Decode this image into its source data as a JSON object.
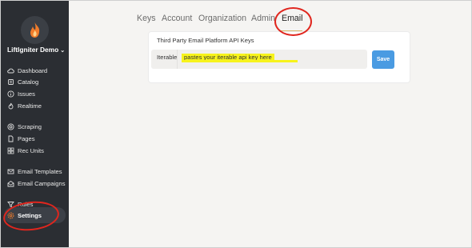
{
  "brand": {
    "name": "LiftIgniter Demo",
    "accent": "#f07c2b"
  },
  "sidebar": {
    "items": [
      {
        "label": "Dashboard",
        "icon": "cloud-icon"
      },
      {
        "label": "Catalog",
        "icon": "book-icon"
      },
      {
        "label": "Issues",
        "icon": "info-icon"
      },
      {
        "label": "Realtime",
        "icon": "flame-icon"
      },
      {
        "label": "Scraping",
        "icon": "target-icon"
      },
      {
        "label": "Pages",
        "icon": "file-icon"
      },
      {
        "label": "Rec Units",
        "icon": "grid-icon"
      },
      {
        "label": "Email Templates",
        "icon": "mail-icon"
      },
      {
        "label": "Email Campaigns",
        "icon": "mail-open-icon"
      },
      {
        "label": "Rules",
        "icon": "filter-icon"
      },
      {
        "label": "Settings",
        "icon": "gear-icon"
      }
    ]
  },
  "tabs": [
    {
      "label": "Keys"
    },
    {
      "label": "Account"
    },
    {
      "label": "Organization"
    },
    {
      "label": "Admin"
    },
    {
      "label": "Email"
    }
  ],
  "active_tab": "Email",
  "card": {
    "title": "Third Party Email Platform API Keys",
    "field_label": "Iterable",
    "field_value": "pastes your iterable api key here",
    "save_label": "Save"
  },
  "colors": {
    "annotation": "#e0261e",
    "highlight": "#f7f31c",
    "save_button": "#4a9be2"
  }
}
